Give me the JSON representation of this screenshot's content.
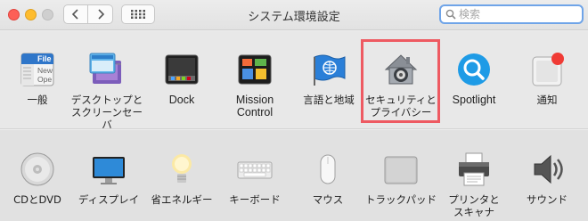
{
  "window": {
    "title": "システム環境設定"
  },
  "search": {
    "placeholder": "検索",
    "value": ""
  },
  "personal_panes": [
    {
      "label": "一般"
    },
    {
      "label": "デスクトップと\nスクリーンセーバ"
    },
    {
      "label": "Dock"
    },
    {
      "label": "Mission\nControl"
    },
    {
      "label": "言語と地域"
    },
    {
      "label": "セキュリティと\nプライバシー"
    },
    {
      "label": "Spotlight"
    },
    {
      "label": "通知"
    }
  ],
  "hardware_panes": [
    {
      "label": "CDとDVD"
    },
    {
      "label": "ディスプレイ"
    },
    {
      "label": "省エネルギー"
    },
    {
      "label": "キーボード"
    },
    {
      "label": "マウス"
    },
    {
      "label": "トラックパッド"
    },
    {
      "label": "プリンタと\nスキャナ"
    },
    {
      "label": "サウンド"
    }
  ],
  "general_icon_text": {
    "line1": "File",
    "line2": "New",
    "line3": "Ope"
  },
  "colors": {
    "highlight": "#ee5a62",
    "search_focus": "#6fa4e8",
    "close": "#fd5f57",
    "minimize": "#febc2e",
    "zoom": "#cfcfcf"
  }
}
